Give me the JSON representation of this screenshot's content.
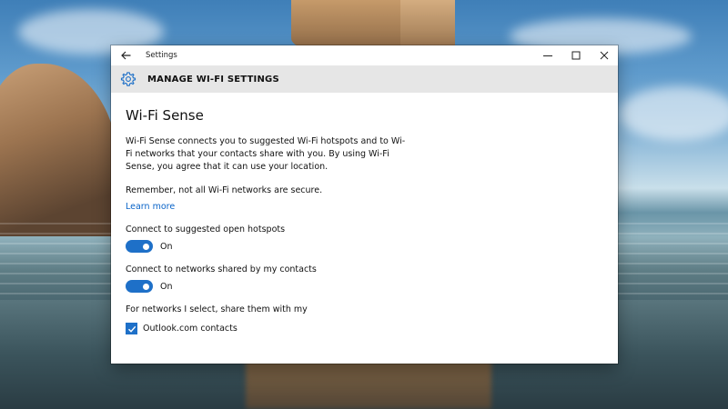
{
  "window": {
    "title": "Settings",
    "controls": {
      "minimize_icon": "minimize-icon",
      "maximize_icon": "maximize-icon",
      "close_icon": "close-icon"
    },
    "back_icon": "back-arrow-icon"
  },
  "header": {
    "icon": "gear-icon",
    "title": "MANAGE WI-FI SETTINGS"
  },
  "main": {
    "section_title": "Wi-Fi Sense",
    "description": "Wi-Fi Sense connects you to suggested Wi-Fi hotspots and to Wi-Fi networks that your contacts share with you. By using Wi-Fi Sense, you agree that it can use your location.",
    "warning": "Remember, not all Wi-Fi networks are secure.",
    "learn_more": "Learn more",
    "settings": [
      {
        "label": "Connect to suggested open hotspots",
        "state": "On",
        "enabled": true
      },
      {
        "label": "Connect to networks shared by my contacts",
        "state": "On",
        "enabled": true
      }
    ],
    "share_label": "For networks I select, share them with my",
    "share_options": [
      {
        "label": "Outlook.com contacts",
        "checked": true
      }
    ]
  },
  "colors": {
    "accent": "#1e70c8",
    "link": "#0a64c8",
    "header_band": "#e6e6e6"
  }
}
